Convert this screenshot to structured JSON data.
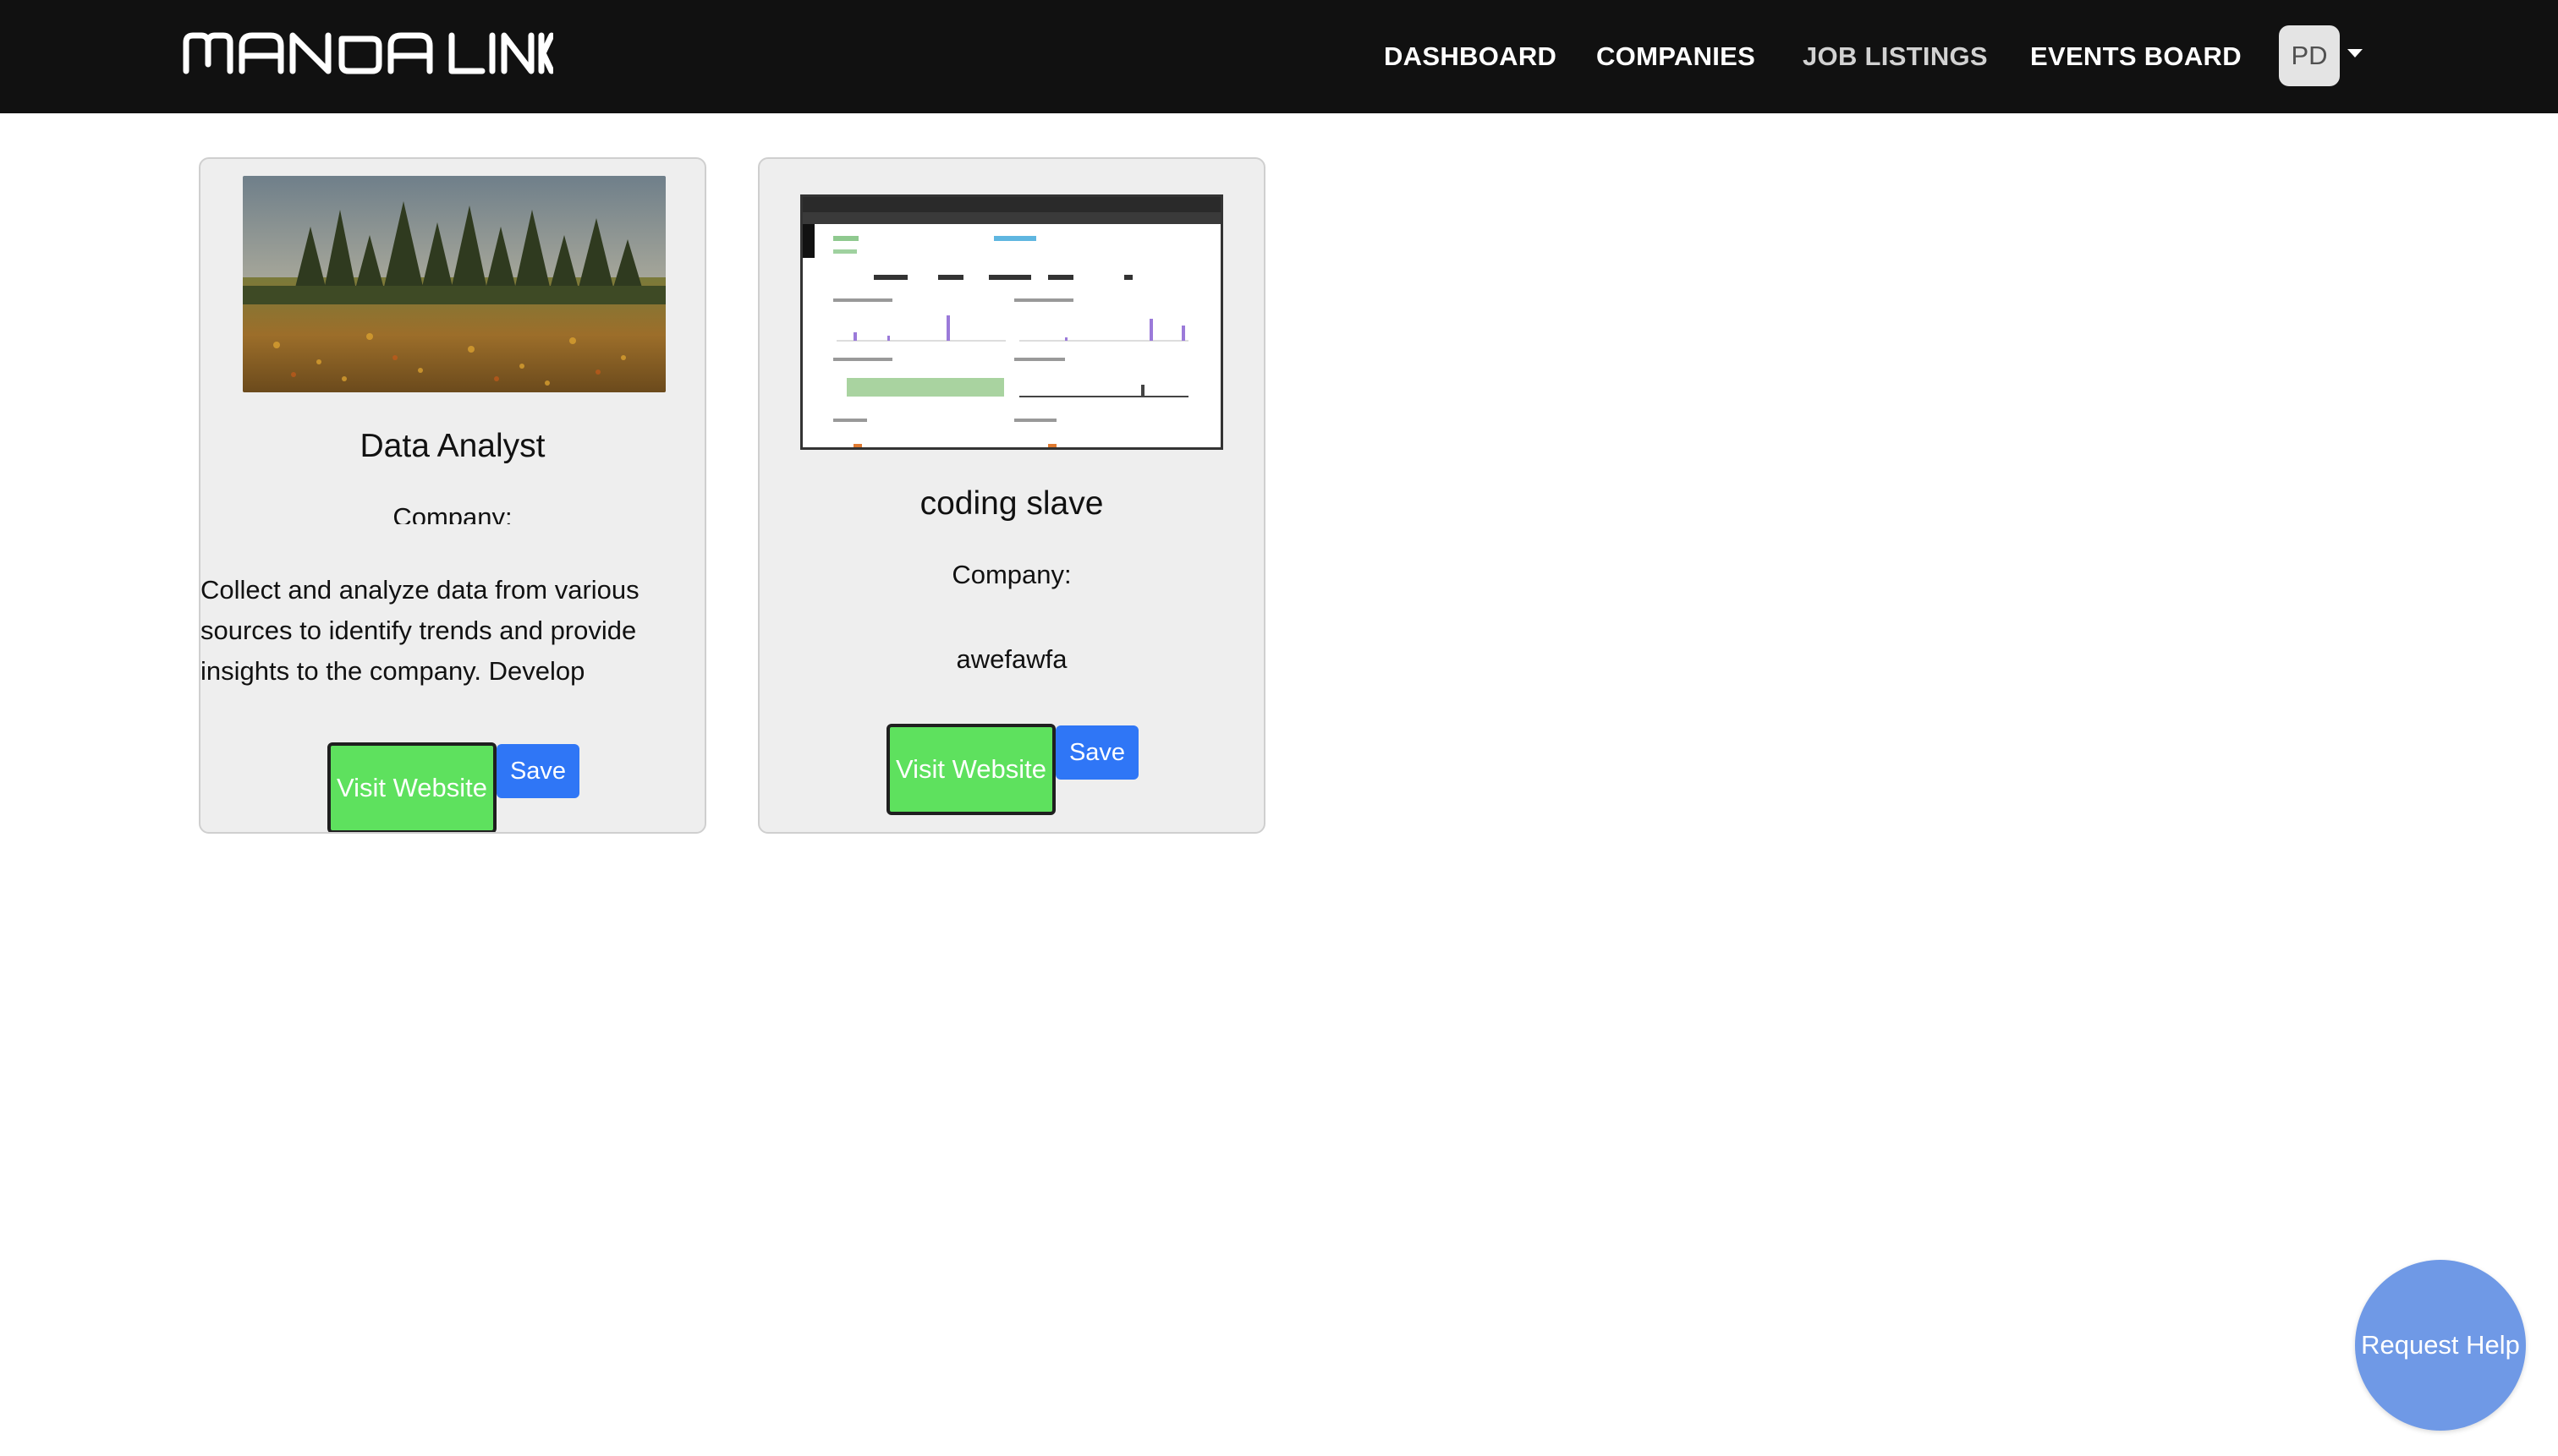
{
  "brand": {
    "name": "MANOA LINK"
  },
  "nav": {
    "dashboard": "DASHBOARD",
    "companies": "COMPANIES",
    "job_listings": "JOB LISTINGS",
    "events_board": "EVENTS BOARD",
    "avatar_initials": "PD"
  },
  "cards": [
    {
      "title": "Data Analyst",
      "company_label": "Company:",
      "description": "Collect and analyze data from various sources to identify trends and provide insights to the company. Develop",
      "visit_label": "Visit Website",
      "save_label": "Save"
    },
    {
      "title": "coding slave",
      "company_label": "Company:",
      "company_name": "awefawfa",
      "visit_label": "Visit Website",
      "save_label": "Save"
    }
  ],
  "help": {
    "label": "Request Help"
  },
  "colors": {
    "navbar": "#111111",
    "card_bg": "#eeeeee",
    "visit_button": "#5ee15e",
    "save_button": "#2f76f6",
    "help_button": "#6f99e6"
  }
}
